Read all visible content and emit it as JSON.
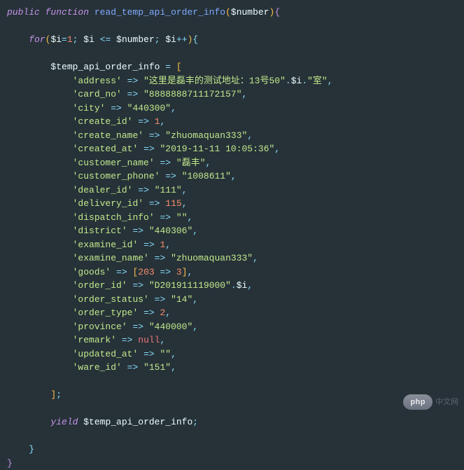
{
  "code": {
    "line1": {
      "kw_public": "public",
      "kw_function": "function",
      "fn_name": "read_temp_api_order_info",
      "param": "$number"
    },
    "line2": {
      "kw_for": "for",
      "var_i": "$i",
      "assign_val": "1",
      "cmp_var": "$i",
      "cmp_op": "<=",
      "cmp_rhs": "$number",
      "inc_var": "$i",
      "inc_op": "++"
    },
    "assign_var": "$temp_api_order_info",
    "entries": {
      "address": {
        "key": "'address'",
        "val_str1": "\"这里是磊丰的测试地址：13号50\"",
        "val_var": "$i",
        "val_str2": "\"室\""
      },
      "card_no": {
        "key": "'card_no'",
        "val": "\"8888888711172157\""
      },
      "city": {
        "key": "'city'",
        "val": "\"440300\""
      },
      "create_id": {
        "key": "'create_id'",
        "val": "1"
      },
      "create_name": {
        "key": "'create_name'",
        "val": "\"zhuomaquan333\""
      },
      "created_at": {
        "key": "'created_at'",
        "val": "\"2019-11-11 10:05:36\""
      },
      "customer_name": {
        "key": "'customer_name'",
        "val": "\"磊丰\""
      },
      "customer_phone": {
        "key": "'customer_phone'",
        "val": "\"1008611\""
      },
      "dealer_id": {
        "key": "'dealer_id'",
        "val": "\"111\""
      },
      "delivery_id": {
        "key": "'delivery_id'",
        "val": "115"
      },
      "dispatch_info": {
        "key": "'dispatch_info'",
        "val": "\"\""
      },
      "district": {
        "key": "'district'",
        "val": "\"440306\""
      },
      "examine_id": {
        "key": "'examine_id'",
        "val": "1"
      },
      "examine_name": {
        "key": "'examine_name'",
        "val": "\"zhuomaquan333\""
      },
      "goods": {
        "key": "'goods'",
        "k": "203",
        "v": "3"
      },
      "order_id": {
        "key": "'order_id'",
        "val_str": "\"D201911119000\"",
        "val_var": "$i"
      },
      "order_status": {
        "key": "'order_status'",
        "val": "\"14\""
      },
      "order_type": {
        "key": "'order_type'",
        "val": "2"
      },
      "province": {
        "key": "'province'",
        "val": "\"440000\""
      },
      "remark": {
        "key": "'remark'",
        "val": "null"
      },
      "updated_at": {
        "key": "'updated_at'",
        "val": "\"\""
      },
      "ware_id": {
        "key": "'ware_id'",
        "val": "\"151\""
      }
    },
    "yield": {
      "kw": "yield",
      "var": "$temp_api_order_info"
    }
  },
  "watermark": {
    "badge": "php",
    "text": "中文网"
  }
}
